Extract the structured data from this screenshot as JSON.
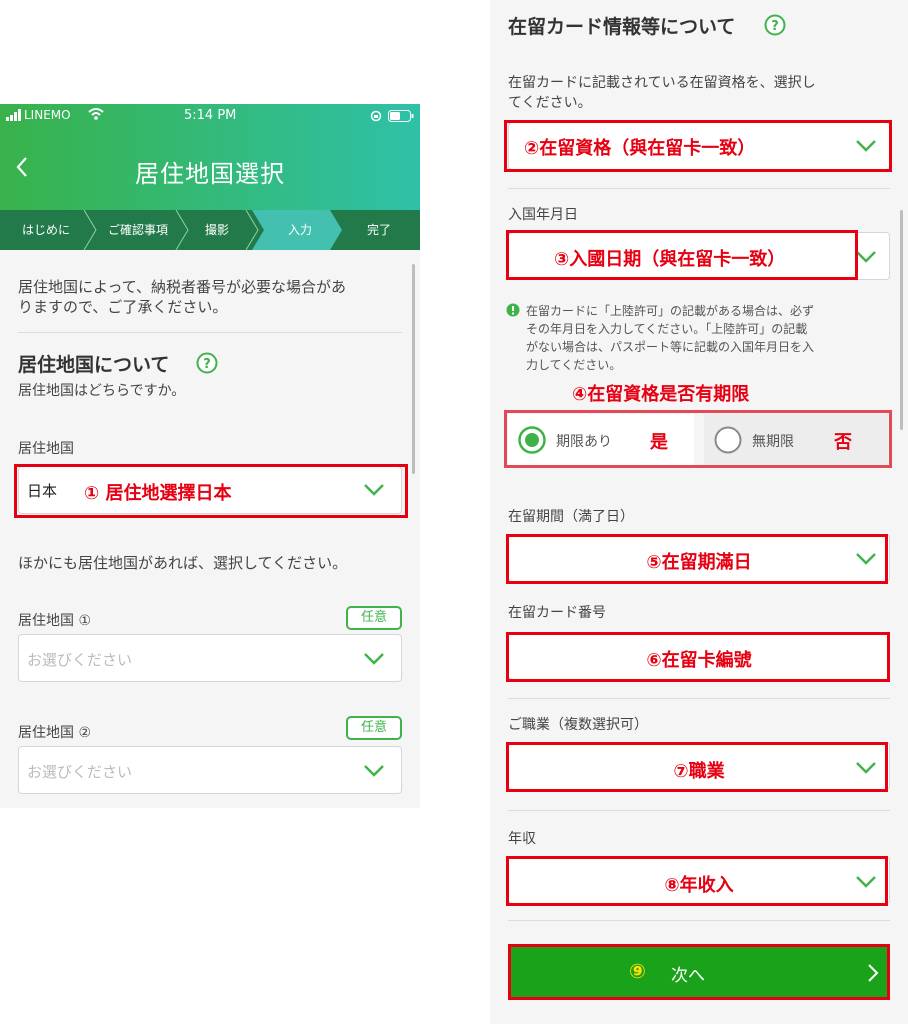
{
  "left": {
    "status": {
      "carrier": "LINEMO",
      "time": "5:14 PM"
    },
    "title": "居住地国選択",
    "steps": [
      "はじめに",
      "ご確認事項",
      "撮影",
      "入力",
      "完了"
    ],
    "intro": [
      "居住地国によって、納税者番号が必要な場合があ",
      "りますので、ご了承ください。"
    ],
    "section_title": "居住地国について",
    "section_sub": "居住地国はどちらですか。",
    "field1": {
      "label": "居住地国",
      "value": "日本",
      "annotation": "① 居住地選擇日本"
    },
    "more_text": "ほかにも居住地国があれば、選択してください。",
    "field2": {
      "label": "居住地国 ①",
      "badge": "任意",
      "placeholder": "お選びください"
    },
    "field3": {
      "label": "居住地国 ②",
      "badge": "任意",
      "placeholder": "お選びください"
    }
  },
  "right": {
    "section_title": "在留カード情報等について",
    "desc": [
      "在留カードに記載されている在留資格を、選択し",
      "てください。"
    ],
    "status_annotation": "②在留資格（與在留卡一致）",
    "entry_label": "入国年月日",
    "entry_annotation": "③入國日期（與在留卡一致）",
    "notice": [
      "在留カードに「上陸許可」の記載がある場合は、必ず",
      "その年月日を入力してください。「上陸許可」の記載",
      "がない場合は、パスポート等に記載の入国年月日を入",
      "力してください。"
    ],
    "period_annotation": "④在留資格是否有期限",
    "radio1": {
      "label": "期限あり",
      "annotation": "是"
    },
    "radio2": {
      "label": "無期限",
      "annotation": "否"
    },
    "expiry_label": "在留期間（満了日）",
    "expiry_annotation": "⑤在留期滿日",
    "card_label": "在留カード番号",
    "card_annotation": "⑥在留卡編號",
    "job_label": "ご職業（複数選択可）",
    "job_annotation": "⑦職業",
    "income_label": "年収",
    "income_annotation": "⑧年收入",
    "next_button": {
      "number": "⑨",
      "label": "次へ"
    }
  },
  "colors": {
    "brand_green": "#3fb34a",
    "annotation_red": "#e60012",
    "button_green": "#1ba21b"
  }
}
